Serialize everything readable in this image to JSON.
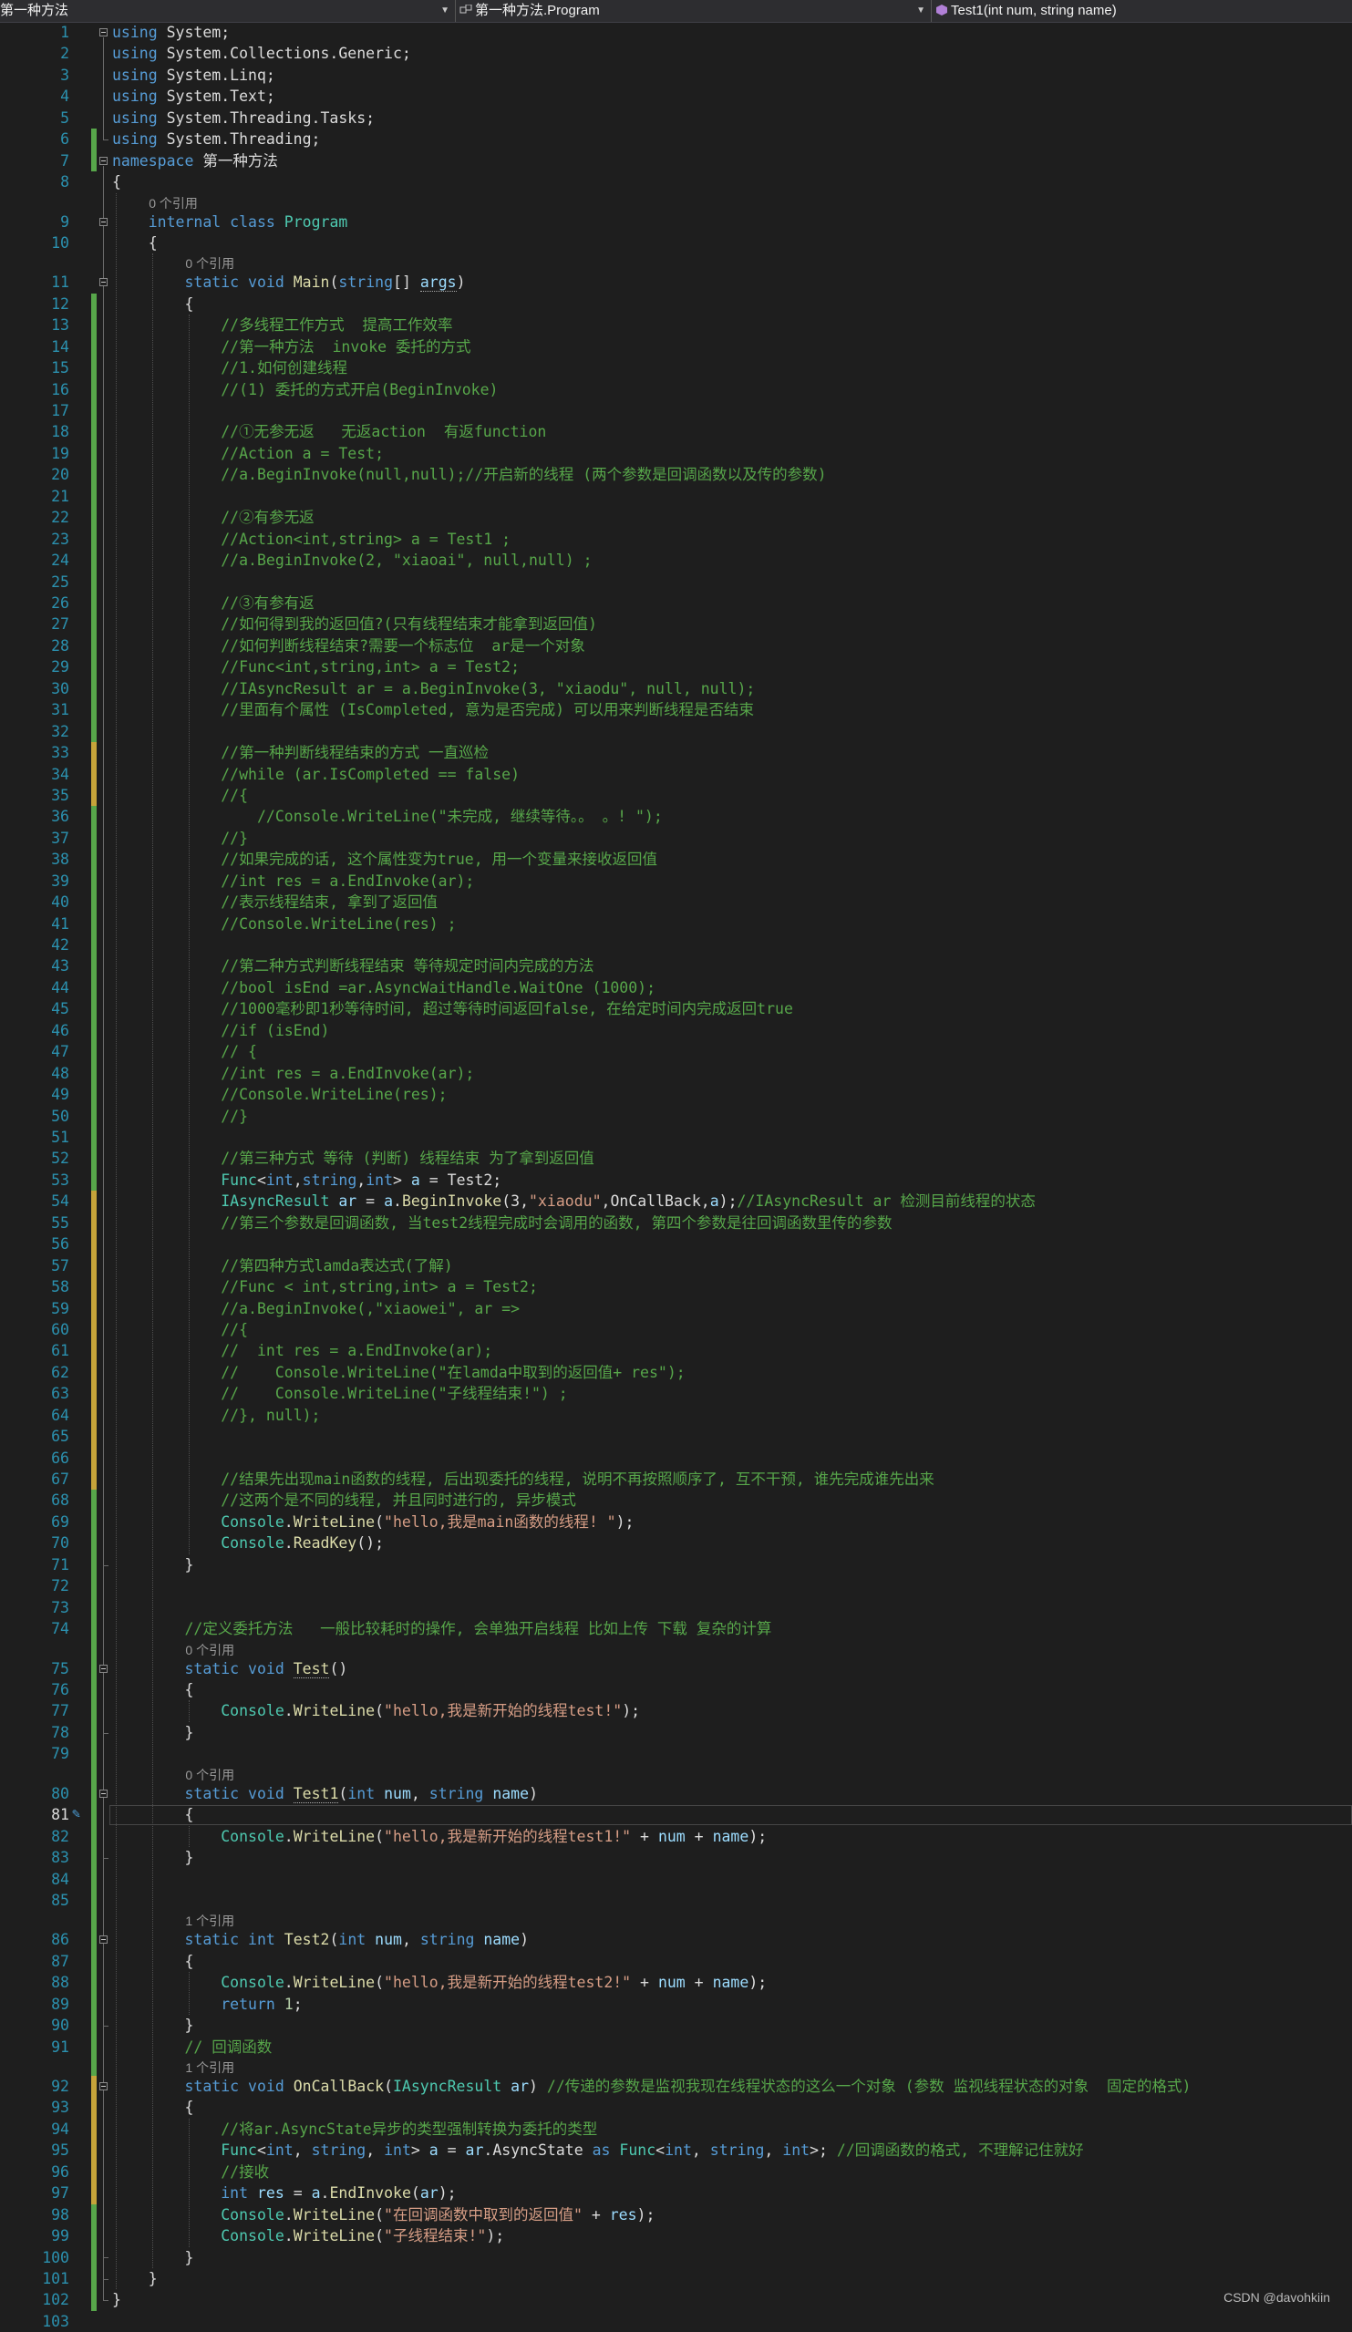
{
  "navbar": {
    "project": "第一种方法",
    "type": "第一种方法.Program",
    "member": "Test1(int num, string name)"
  },
  "watermark": "CSDN @davohkiin",
  "refs": {
    "zero": "0 个引用",
    "one": "1 个引用"
  },
  "lines": [
    [
      [
        "kw",
        "using"
      ],
      [
        "pl",
        " System;"
      ]
    ],
    [
      [
        "kw",
        "using"
      ],
      [
        "pl",
        " System.Collections.Generic;"
      ]
    ],
    [
      [
        "kw",
        "using"
      ],
      [
        "pl",
        " System.Linq;"
      ]
    ],
    [
      [
        "kw",
        "using"
      ],
      [
        "pl",
        " System.Text;"
      ]
    ],
    [
      [
        "kw",
        "using"
      ],
      [
        "pl",
        " System.Threading.Tasks;"
      ]
    ],
    [
      [
        "kw",
        "using"
      ],
      [
        "pl",
        " System.Threading;"
      ]
    ],
    [
      [
        "kw",
        "namespace"
      ],
      [
        "pl",
        " 第一种方法"
      ]
    ],
    [
      [
        "pl",
        "{"
      ]
    ],
    [
      [
        "pl",
        "    "
      ],
      [
        "kw",
        "internal"
      ],
      [
        "pl",
        " "
      ],
      [
        "kw",
        "class"
      ],
      [
        "pl",
        " "
      ],
      [
        "ty",
        "Program"
      ]
    ],
    [
      [
        "pl",
        "    {"
      ]
    ],
    [
      [
        "pl",
        "        "
      ],
      [
        "kw",
        "static"
      ],
      [
        "pl",
        " "
      ],
      [
        "kw",
        "void"
      ],
      [
        "pl",
        " "
      ],
      [
        "mt",
        "Main"
      ],
      [
        "pl",
        "("
      ],
      [
        "kw",
        "string"
      ],
      [
        "pl",
        "[] "
      ],
      [
        "pm",
        "args"
      ],
      [
        "pl",
        ")"
      ]
    ],
    [
      [
        "pl",
        "        {"
      ]
    ],
    [
      [
        "pl",
        "            "
      ],
      [
        "cm",
        "//多线程工作方式  提高工作效率"
      ]
    ],
    [
      [
        "pl",
        "            "
      ],
      [
        "cm",
        "//第一种方法  invoke 委托的方式"
      ]
    ],
    [
      [
        "pl",
        "            "
      ],
      [
        "cm",
        "//1.如何创建线程"
      ]
    ],
    [
      [
        "pl",
        "            "
      ],
      [
        "cm",
        "//(1) 委托的方式开启(BeginInvoke)"
      ]
    ],
    [],
    [
      [
        "pl",
        "            "
      ],
      [
        "cm",
        "//①无参无返   无返action  有返function"
      ]
    ],
    [
      [
        "pl",
        "            "
      ],
      [
        "cm",
        "//Action a = Test;"
      ]
    ],
    [
      [
        "pl",
        "            "
      ],
      [
        "cm",
        "//a.BeginInvoke(null,null);//开启新的线程 (两个参数是回调函数以及传的参数)"
      ]
    ],
    [],
    [
      [
        "pl",
        "            "
      ],
      [
        "cm",
        "//②有参无返"
      ]
    ],
    [
      [
        "pl",
        "            "
      ],
      [
        "cm",
        "//Action<int,string> a = Test1 ;"
      ]
    ],
    [
      [
        "pl",
        "            "
      ],
      [
        "cm",
        "//a.BeginInvoke(2, \"xiaoai\", null,null) ;"
      ]
    ],
    [],
    [
      [
        "pl",
        "            "
      ],
      [
        "cm",
        "//③有参有返"
      ]
    ],
    [
      [
        "pl",
        "            "
      ],
      [
        "cm",
        "//如何得到我的返回值?(只有线程结束才能拿到返回值)"
      ]
    ],
    [
      [
        "pl",
        "            "
      ],
      [
        "cm",
        "//如何判断线程结束?需要一个标志位  ar是一个对象"
      ]
    ],
    [
      [
        "pl",
        "            "
      ],
      [
        "cm",
        "//Func<int,string,int> a = Test2;"
      ]
    ],
    [
      [
        "pl",
        "            "
      ],
      [
        "cm",
        "//IAsyncResult ar = a.BeginInvoke(3, \"xiaodu\", null, null);"
      ]
    ],
    [
      [
        "pl",
        "            "
      ],
      [
        "cm",
        "//里面有个属性 (IsCompleted, 意为是否完成) 可以用来判断线程是否结束"
      ]
    ],
    [],
    [
      [
        "pl",
        "            "
      ],
      [
        "cm",
        "//第一种判断线程结束的方式 一直巡检"
      ]
    ],
    [
      [
        "pl",
        "            "
      ],
      [
        "cm",
        "//while (ar.IsCompleted == false)"
      ]
    ],
    [
      [
        "pl",
        "            "
      ],
      [
        "cm",
        "//{"
      ]
    ],
    [
      [
        "pl",
        "            "
      ],
      [
        "cm",
        "    //Console.WriteLine(\"未完成, 继续等待。。 。! \");"
      ]
    ],
    [
      [
        "pl",
        "            "
      ],
      [
        "cm",
        "//}"
      ]
    ],
    [
      [
        "pl",
        "            "
      ],
      [
        "cm",
        "//如果完成的话, 这个属性变为true, 用一个变量来接收返回值"
      ]
    ],
    [
      [
        "pl",
        "            "
      ],
      [
        "cm",
        "//int res = a.EndInvoke(ar);"
      ]
    ],
    [
      [
        "pl",
        "            "
      ],
      [
        "cm",
        "//表示线程结束, 拿到了返回值"
      ]
    ],
    [
      [
        "pl",
        "            "
      ],
      [
        "cm",
        "//Console.WriteLine(res) ;"
      ]
    ],
    [],
    [
      [
        "pl",
        "            "
      ],
      [
        "cm",
        "//第二种方式判断线程结束 等待规定时间内完成的方法"
      ]
    ],
    [
      [
        "pl",
        "            "
      ],
      [
        "cm",
        "//bool isEnd =ar.AsyncWaitHandle.WaitOne (1000);"
      ]
    ],
    [
      [
        "pl",
        "            "
      ],
      [
        "cm",
        "//1000毫秒即1秒等待时间, 超过等待时间返回false, 在给定时间内完成返回true"
      ]
    ],
    [
      [
        "pl",
        "            "
      ],
      [
        "cm",
        "//if (isEnd)"
      ]
    ],
    [
      [
        "pl",
        "            "
      ],
      [
        "cm",
        "// {"
      ]
    ],
    [
      [
        "pl",
        "            "
      ],
      [
        "cm",
        "//int res = a.EndInvoke(ar);"
      ]
    ],
    [
      [
        "pl",
        "            "
      ],
      [
        "cm",
        "//Console.WriteLine(res);"
      ]
    ],
    [
      [
        "pl",
        "            "
      ],
      [
        "cm",
        "//}"
      ]
    ],
    [],
    [
      [
        "pl",
        "            "
      ],
      [
        "cm",
        "//第三种方式 等待 (判断) 线程结束 为了拿到返回值"
      ]
    ],
    [
      [
        "pl",
        "            "
      ],
      [
        "ty",
        "Func"
      ],
      [
        "pl",
        "<"
      ],
      [
        "kw",
        "int"
      ],
      [
        "pl",
        ","
      ],
      [
        "kw",
        "string"
      ],
      [
        "pl",
        ","
      ],
      [
        "kw",
        "int"
      ],
      [
        "pl",
        "> "
      ],
      [
        "pm",
        "a"
      ],
      [
        "pl",
        " = Test2;"
      ]
    ],
    [
      [
        "pl",
        "            "
      ],
      [
        "ty",
        "IAsyncResult"
      ],
      [
        "pl",
        " "
      ],
      [
        "pm",
        "ar"
      ],
      [
        "pl",
        " = "
      ],
      [
        "pm",
        "a"
      ],
      [
        "pl",
        "."
      ],
      [
        "mt",
        "BeginInvoke"
      ],
      [
        "pl",
        "(3,"
      ],
      [
        "st",
        "\"xiaodu\""
      ],
      [
        "pl",
        ",OnCallBack,"
      ],
      [
        "pm",
        "a"
      ],
      [
        "pl",
        ");"
      ],
      [
        "cm",
        "//IAsyncResult ar 检测目前线程的状态"
      ]
    ],
    [
      [
        "pl",
        "            "
      ],
      [
        "cm",
        "//第三个参数是回调函数, 当test2线程完成时会调用的函数, 第四个参数是往回调函数里传的参数"
      ]
    ],
    [],
    [
      [
        "pl",
        "            "
      ],
      [
        "cm",
        "//第四种方式lamda表达式(了解)"
      ]
    ],
    [
      [
        "pl",
        "            "
      ],
      [
        "cm",
        "//Func < int,string,int> a = Test2;"
      ]
    ],
    [
      [
        "pl",
        "            "
      ],
      [
        "cm",
        "//a.BeginInvoke(,\"xiaowei\", ar =>"
      ]
    ],
    [
      [
        "pl",
        "            "
      ],
      [
        "cm",
        "//{"
      ]
    ],
    [
      [
        "pl",
        "            "
      ],
      [
        "cm",
        "//  int res = a.EndInvoke(ar);"
      ]
    ],
    [
      [
        "pl",
        "            "
      ],
      [
        "cm",
        "//    Console.WriteLine(\"在lamda中取到的返回值+ res\");"
      ]
    ],
    [
      [
        "pl",
        "            "
      ],
      [
        "cm",
        "//    Console.WriteLine(\"子线程结束!\") ;"
      ]
    ],
    [
      [
        "pl",
        "            "
      ],
      [
        "cm",
        "//}, null);"
      ]
    ],
    [],
    [],
    [
      [
        "pl",
        "            "
      ],
      [
        "cm",
        "//结果先出现main函数的线程, 后出现委托的线程, 说明不再按照顺序了, 互不干预, 谁先完成谁先出来"
      ]
    ],
    [
      [
        "pl",
        "            "
      ],
      [
        "cm",
        "//这两个是不同的线程, 并且同时进行的, 异步模式"
      ]
    ],
    [
      [
        "pl",
        "            "
      ],
      [
        "ty",
        "Console"
      ],
      [
        "pl",
        "."
      ],
      [
        "mt",
        "WriteLine"
      ],
      [
        "pl",
        "("
      ],
      [
        "st",
        "\"hello,我是main函数的线程! \""
      ],
      [
        "pl",
        ");"
      ]
    ],
    [
      [
        "pl",
        "            "
      ],
      [
        "ty",
        "Console"
      ],
      [
        "pl",
        "."
      ],
      [
        "mt",
        "ReadKey"
      ],
      [
        "pl",
        "();"
      ]
    ],
    [
      [
        "pl",
        "        }"
      ]
    ],
    [],
    [],
    [
      [
        "pl",
        "        "
      ],
      [
        "cm",
        "//定义委托方法   一般比较耗时的操作, 会单独开启线程 比如上传 下载 复杂的计算"
      ]
    ],
    [
      [
        "pl",
        "        "
      ],
      [
        "kw",
        "static"
      ],
      [
        "pl",
        " "
      ],
      [
        "kw",
        "void"
      ],
      [
        "pl",
        " "
      ],
      [
        "mt",
        "Test"
      ],
      [
        "pl",
        "()"
      ]
    ],
    [
      [
        "pl",
        "        {"
      ]
    ],
    [
      [
        "pl",
        "            "
      ],
      [
        "ty",
        "Console"
      ],
      [
        "pl",
        "."
      ],
      [
        "mt",
        "WriteLine"
      ],
      [
        "pl",
        "("
      ],
      [
        "st",
        "\"hello,我是新开始的线程test!\""
      ],
      [
        "pl",
        ");"
      ]
    ],
    [
      [
        "pl",
        "        }"
      ]
    ],
    [],
    [
      [
        "pl",
        "        "
      ],
      [
        "kw",
        "static"
      ],
      [
        "pl",
        " "
      ],
      [
        "kw",
        "void"
      ],
      [
        "pl",
        " "
      ],
      [
        "mt",
        "Test1"
      ],
      [
        "pl",
        "("
      ],
      [
        "kw",
        "int"
      ],
      [
        "pl",
        " "
      ],
      [
        "pm",
        "num"
      ],
      [
        "pl",
        ", "
      ],
      [
        "kw",
        "string"
      ],
      [
        "pl",
        " "
      ],
      [
        "pm",
        "name"
      ],
      [
        "pl",
        ")"
      ]
    ],
    [
      [
        "pl",
        "        {"
      ]
    ],
    [
      [
        "pl",
        "            "
      ],
      [
        "ty",
        "Console"
      ],
      [
        "pl",
        "."
      ],
      [
        "mt",
        "WriteLine"
      ],
      [
        "pl",
        "("
      ],
      [
        "st",
        "\"hello,我是新开始的线程test1!\""
      ],
      [
        "pl",
        " + "
      ],
      [
        "pm",
        "num"
      ],
      [
        "pl",
        " + "
      ],
      [
        "pm",
        "name"
      ],
      [
        "pl",
        ");"
      ]
    ],
    [
      [
        "pl",
        "        }"
      ]
    ],
    [],
    [],
    [
      [
        "pl",
        "        "
      ],
      [
        "kw",
        "static"
      ],
      [
        "pl",
        " "
      ],
      [
        "kw",
        "int"
      ],
      [
        "pl",
        " "
      ],
      [
        "mt",
        "Test2"
      ],
      [
        "pl",
        "("
      ],
      [
        "kw",
        "int"
      ],
      [
        "pl",
        " "
      ],
      [
        "pm",
        "num"
      ],
      [
        "pl",
        ", "
      ],
      [
        "kw",
        "string"
      ],
      [
        "pl",
        " "
      ],
      [
        "pm",
        "name"
      ],
      [
        "pl",
        ")"
      ]
    ],
    [
      [
        "pl",
        "        {"
      ]
    ],
    [
      [
        "pl",
        "            "
      ],
      [
        "ty",
        "Console"
      ],
      [
        "pl",
        "."
      ],
      [
        "mt",
        "WriteLine"
      ],
      [
        "pl",
        "("
      ],
      [
        "st",
        "\"hello,我是新开始的线程test2!\""
      ],
      [
        "pl",
        " + "
      ],
      [
        "pm",
        "num"
      ],
      [
        "pl",
        " + "
      ],
      [
        "pm",
        "name"
      ],
      [
        "pl",
        ");"
      ]
    ],
    [
      [
        "pl",
        "            "
      ],
      [
        "kw",
        "return"
      ],
      [
        "pl",
        " "
      ],
      [
        "nm",
        "1"
      ],
      [
        "pl",
        ";"
      ]
    ],
    [
      [
        "pl",
        "        }"
      ]
    ],
    [
      [
        "pl",
        "        "
      ],
      [
        "cm",
        "// 回调函数"
      ]
    ],
    [
      [
        "pl",
        "        "
      ],
      [
        "kw",
        "static"
      ],
      [
        "pl",
        " "
      ],
      [
        "kw",
        "void"
      ],
      [
        "pl",
        " "
      ],
      [
        "mt",
        "OnCallBack"
      ],
      [
        "pl",
        "("
      ],
      [
        "ty",
        "IAsyncResult"
      ],
      [
        "pl",
        " "
      ],
      [
        "pm",
        "ar"
      ],
      [
        "pl",
        ") "
      ],
      [
        "cm",
        "//传递的参数是监视我现在线程状态的这么一个对象 (参数 监视线程状态的对象  固定的格式)"
      ]
    ],
    [
      [
        "pl",
        "        {"
      ]
    ],
    [
      [
        "pl",
        "            "
      ],
      [
        "cm",
        "//将ar.AsyncState异步的类型强制转换为委托的类型"
      ]
    ],
    [
      [
        "pl",
        "            "
      ],
      [
        "ty",
        "Func"
      ],
      [
        "pl",
        "<"
      ],
      [
        "kw",
        "int"
      ],
      [
        "pl",
        ", "
      ],
      [
        "kw",
        "string"
      ],
      [
        "pl",
        ", "
      ],
      [
        "kw",
        "int"
      ],
      [
        "pl",
        "> "
      ],
      [
        "pm",
        "a"
      ],
      [
        "pl",
        " = "
      ],
      [
        "pm",
        "ar"
      ],
      [
        "pl",
        ".AsyncState "
      ],
      [
        "kw",
        "as"
      ],
      [
        "pl",
        " "
      ],
      [
        "ty",
        "Func"
      ],
      [
        "pl",
        "<"
      ],
      [
        "kw",
        "int"
      ],
      [
        "pl",
        ", "
      ],
      [
        "kw",
        "string"
      ],
      [
        "pl",
        ", "
      ],
      [
        "kw",
        "int"
      ],
      [
        "pl",
        ">; "
      ],
      [
        "cm",
        "//回调函数的格式, 不理解记住就好"
      ]
    ],
    [
      [
        "pl",
        "            "
      ],
      [
        "cm",
        "//接收"
      ]
    ],
    [
      [
        "pl",
        "            "
      ],
      [
        "kw",
        "int"
      ],
      [
        "pl",
        " "
      ],
      [
        "pm",
        "res"
      ],
      [
        "pl",
        " = "
      ],
      [
        "pm",
        "a"
      ],
      [
        "pl",
        "."
      ],
      [
        "mt",
        "EndInvoke"
      ],
      [
        "pl",
        "("
      ],
      [
        "pm",
        "ar"
      ],
      [
        "pl",
        ");"
      ]
    ],
    [
      [
        "pl",
        "            "
      ],
      [
        "ty",
        "Console"
      ],
      [
        "pl",
        "."
      ],
      [
        "mt",
        "WriteLine"
      ],
      [
        "pl",
        "("
      ],
      [
        "st",
        "\"在回调函数中取到的返回值\""
      ],
      [
        "pl",
        " + "
      ],
      [
        "pm",
        "res"
      ],
      [
        "pl",
        ");"
      ]
    ],
    [
      [
        "pl",
        "            "
      ],
      [
        "ty",
        "Console"
      ],
      [
        "pl",
        "."
      ],
      [
        "mt",
        "WriteLine"
      ],
      [
        "pl",
        "("
      ],
      [
        "st",
        "\"子线程结束!\""
      ],
      [
        "pl",
        ");"
      ]
    ],
    [
      [
        "pl",
        "        }"
      ]
    ],
    [
      [
        "pl",
        "    }"
      ]
    ],
    [
      [
        "pl",
        "}"
      ]
    ],
    []
  ],
  "refs_before": {
    "9": "zero",
    "11": "zero",
    "75": "zero",
    "80": "zero",
    "86": "one",
    "92": "one"
  },
  "current_line": 81,
  "colors": {
    "background": "#1e1e1e",
    "line_number": "#2b91af",
    "keyword": "#569cd6",
    "type": "#4ec9b0",
    "comment": "#57a64a",
    "string": "#d69d85",
    "method": "#dcdcaa",
    "parameter": "#9cdcfe",
    "change_saved": "#57a64a",
    "change_unsaved": "#c6a43a"
  },
  "icons": [
    "class-icon",
    "method-icon",
    "dropdown-arrow-icon",
    "fold-toggle-icon",
    "quick-action-pencil-icon"
  ]
}
